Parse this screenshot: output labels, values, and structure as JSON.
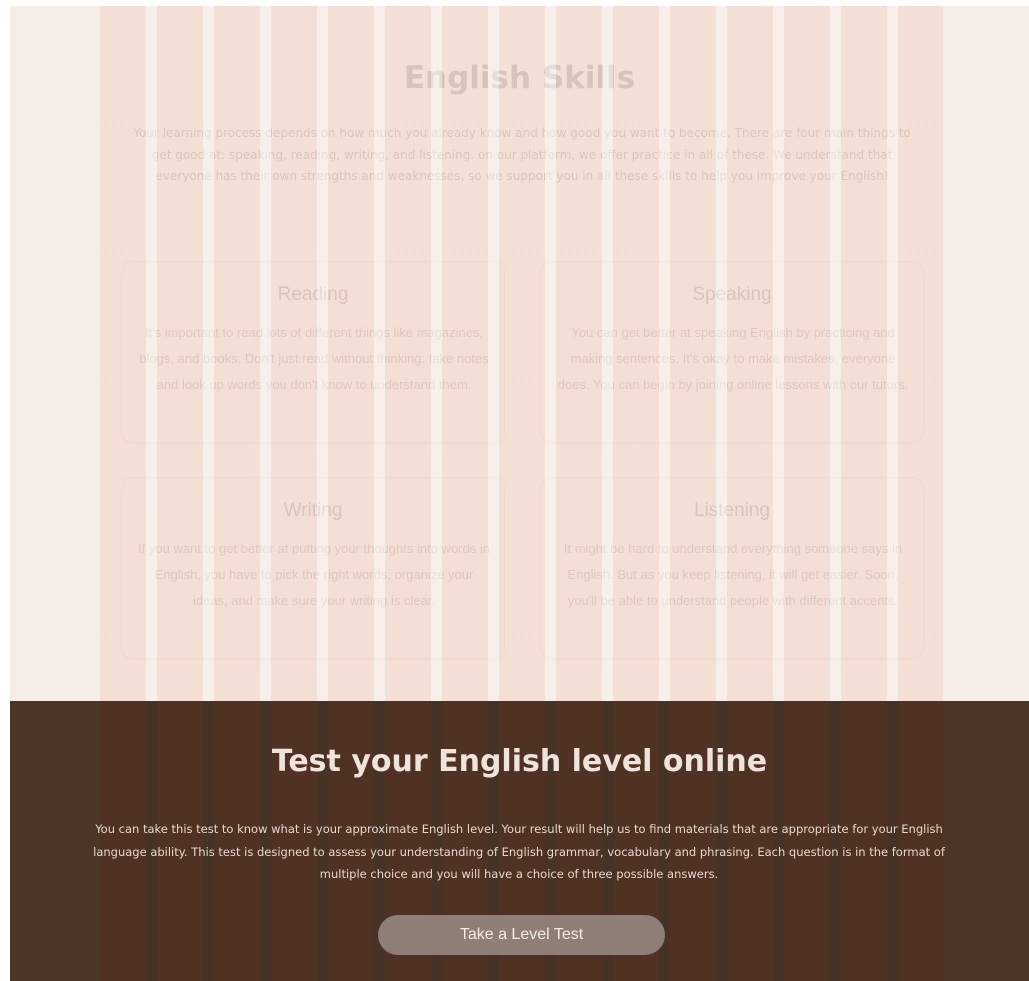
{
  "skills": {
    "title": "English Skills",
    "intro": "Your learning process depends on how much you already know and how good you want to become. There are four main things to get good at: speaking, reading, writing, and listening. on our platform, we offer practice in all of these. We understand that everyone has their own strengths and weaknesses, so we support you in all these skills to help you improve your English!",
    "cards": [
      {
        "title": "Reading",
        "text": "It's important to read lots of different things like magazines, blogs, and books. Don't just read without thinking: take notes and look up words you don't know to understand them."
      },
      {
        "title": "Speaking",
        "text": "You can get better at speaking English by practicing and making sentences. It's okay to make mistakes, everyone does. You can begin by joining online lessons with our tutors."
      },
      {
        "title": "Writing",
        "text": "If you want to get better at putting your thoughts into words in English, you have to pick the right words, organize your ideas, and make sure your writing is clear."
      },
      {
        "title": "Listening",
        "text": "It might be hard to understand everything someone says in English. But as you keep listening, it will get easier. Soon, you'll be able to understand people with different accents."
      }
    ]
  },
  "level_test": {
    "title": "Test your English level online",
    "text": "You can take this test to know what is your approximate English level. Your result will help us to find materials  that are appropriate for your English language ability. This test is designed to assess your understanding of English grammar, vocabulary and phrasing. Each question is in the format of multiple choice and you will have a choice of three possible answers.",
    "button_label": "Take a Level Test"
  },
  "colors": {
    "page_bg": "#f6ede6",
    "stripe": "#f4ddd4",
    "dark_band": "#4a3527",
    "button": "#8f7e78",
    "heading": "#3b3139"
  }
}
